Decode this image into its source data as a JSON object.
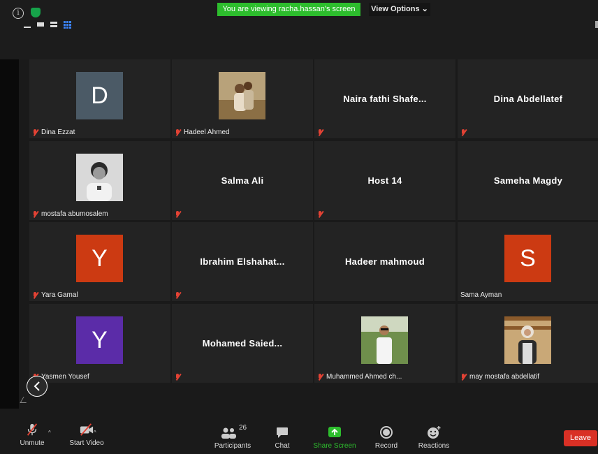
{
  "banner": {
    "text": "You are viewing racha.hassan's screen"
  },
  "view_options": {
    "label": "View Options ⌄"
  },
  "participants": [
    {
      "name": "Dina Ezzat",
      "type": "letter",
      "letter": "D",
      "color": "#4b5a66",
      "muted": true,
      "label": true
    },
    {
      "name": "Hadeel Ahmed",
      "type": "photo",
      "photo": "couple-photo",
      "muted": true,
      "label": true
    },
    {
      "name": "Naira fathi Shafe...",
      "type": "name",
      "muted": true,
      "label": false
    },
    {
      "name": "Dina Abdellatef",
      "type": "name",
      "muted": true,
      "label": false
    },
    {
      "name": "mostafa abumosalem",
      "type": "photo",
      "photo": "man-bw-photo",
      "muted": true,
      "label": true
    },
    {
      "name": "Salma Ali",
      "type": "name",
      "muted": true,
      "label": false
    },
    {
      "name": "Host 14",
      "type": "name",
      "muted": true,
      "label": false
    },
    {
      "name": "Sameha Magdy",
      "type": "name",
      "muted": false,
      "label": false
    },
    {
      "name": "Yara Gamal",
      "type": "letter",
      "letter": "Y",
      "color": "#cc3a12",
      "muted": true,
      "label": true
    },
    {
      "name": "Ibrahim Elshahat...",
      "type": "name",
      "muted": true,
      "label": false
    },
    {
      "name": "Hadeer mahmoud",
      "type": "name",
      "muted": false,
      "label": false
    },
    {
      "name": "Sama Ayman",
      "type": "letter",
      "letter": "S",
      "color": "#cc3a12",
      "muted": false,
      "label": true
    },
    {
      "name": "Yasmen Yousef",
      "type": "letter",
      "letter": "Y",
      "color": "#5b2ca8",
      "muted": true,
      "label": true
    },
    {
      "name": "Mohamed Saied...",
      "type": "name",
      "muted": true,
      "label": false
    },
    {
      "name": "Muhammed Ahmed ch...",
      "type": "photo",
      "photo": "man-outdoor-photo",
      "muted": true,
      "label": true
    },
    {
      "name": "may mostafa abdellatif",
      "type": "photo",
      "photo": "woman-photo",
      "muted": true,
      "label": true
    }
  ],
  "toolbar": {
    "unmute": "Unmute",
    "start_video": "Start Video",
    "participants": "Participants",
    "participants_count": "26",
    "chat": "Chat",
    "share_screen": "Share Screen",
    "record": "Record",
    "reactions": "Reactions",
    "leave": "Leave"
  },
  "colors": {
    "accent_green": "#2dbd2d",
    "leave_red": "#d93025"
  }
}
